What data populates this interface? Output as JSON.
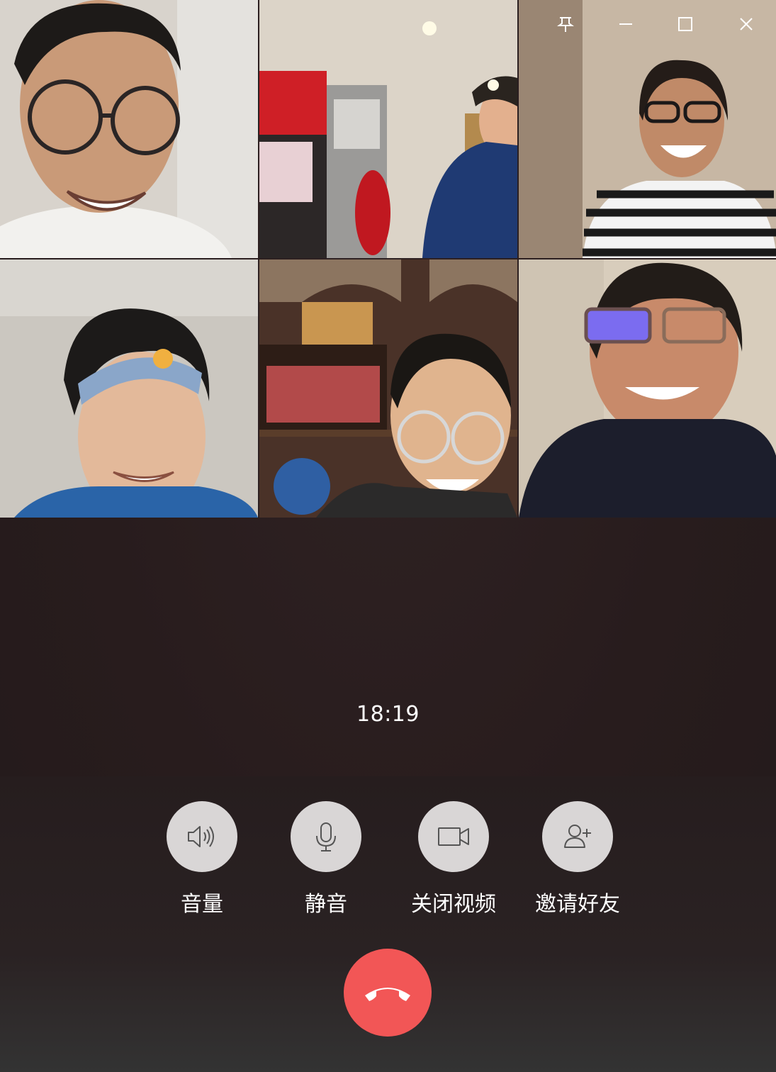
{
  "window": {
    "controls": {
      "pin_icon": "pin-icon",
      "minimize_icon": "minimize-icon",
      "maximize_icon": "maximize-icon",
      "close_icon": "close-icon"
    }
  },
  "call": {
    "duration": "18:19",
    "participants_count": 6
  },
  "controls": [
    {
      "label": "音量",
      "icon": "speaker-icon"
    },
    {
      "label": "静音",
      "icon": "microphone-icon"
    },
    {
      "label": "关闭视频",
      "icon": "video-camera-icon"
    },
    {
      "label": "邀请好友",
      "icon": "add-user-icon"
    }
  ],
  "hangup": {
    "icon": "hang-up-icon",
    "color": "#f25656"
  },
  "colors": {
    "background": "#281c1d",
    "button": "#d9d6d6",
    "icon_stroke": "#555555",
    "hangup": "#f25656"
  }
}
